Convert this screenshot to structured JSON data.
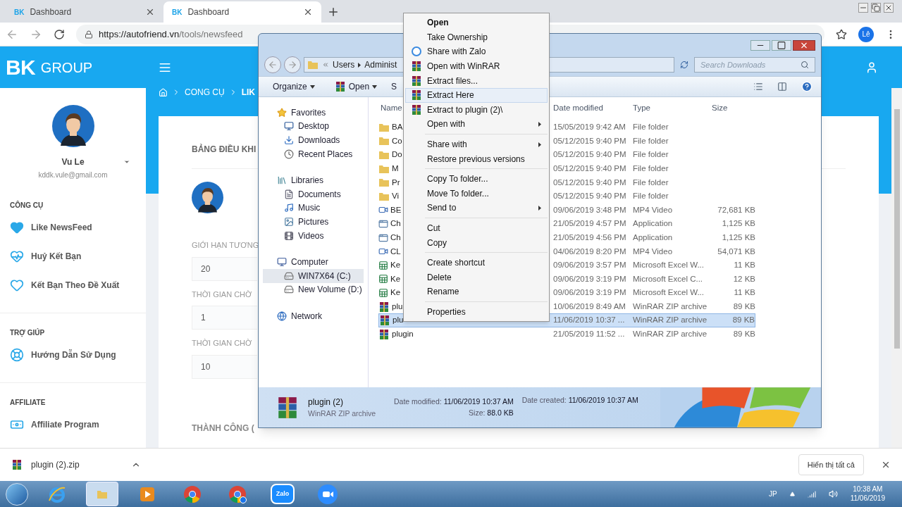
{
  "browser": {
    "tabs": [
      {
        "favicon": "BK",
        "title": "Dashboard",
        "selected": false
      },
      {
        "favicon": "BK",
        "title": "Dashboard",
        "selected": true
      }
    ],
    "url_host": "https://autofriend.vn",
    "url_path": "/tools/newsfeed",
    "profile": "Lê"
  },
  "page": {
    "logo": {
      "mark": "BK",
      "word": "GROUP"
    },
    "breadcrumb": [
      "CÔNG CỤ",
      "LIK"
    ],
    "user": {
      "name": "Vu Le",
      "email": "kddk.vule@gmail.com"
    },
    "sidebar": [
      {
        "title": "CÔNG CỤ",
        "items": [
          {
            "label": "Like NewsFeed",
            "kind": "heart"
          },
          {
            "label": "Huỷ Kết Bạn",
            "kind": "pulse"
          },
          {
            "label": "Kết Bạn Theo Đề Xuất",
            "kind": "heart-outline"
          }
        ]
      },
      {
        "title": "TRỢ GIÚP",
        "items": [
          {
            "label": "Hướng Dẫn Sử Dụng",
            "kind": "lifebuoy"
          }
        ]
      },
      {
        "title": "AFFILIATE",
        "items": [
          {
            "label": "Affiliate Program",
            "kind": "money"
          }
        ]
      }
    ],
    "dashboard": {
      "title": "BẢNG ĐIỀU KHI",
      "fields": [
        {
          "label": "GIỚI HẠN TƯƠNG",
          "value": "20"
        },
        {
          "label": "THỜI GIAN CHỜ",
          "value": "1"
        },
        {
          "label": "THỜI GIAN CHỜ",
          "value": "10"
        }
      ],
      "success": "THÀNH CÔNG ("
    }
  },
  "explorer": {
    "path": [
      "Users",
      "Administ"
    ],
    "search": "Search Downloads",
    "toolbar": [
      "Organize",
      "Open",
      "S"
    ],
    "tree": [
      {
        "label": "Favorites",
        "kind": "star",
        "children": [
          {
            "label": "Desktop",
            "kind": "desktop",
            "selected": false
          },
          {
            "label": "Downloads",
            "kind": "downloads",
            "selected": false
          },
          {
            "label": "Recent Places",
            "kind": "recent",
            "selected": false
          }
        ]
      },
      {
        "label": "Libraries",
        "kind": "libraries",
        "children": [
          {
            "label": "Documents",
            "kind": "documents",
            "selected": false
          },
          {
            "label": "Music",
            "kind": "music",
            "selected": false
          },
          {
            "label": "Pictures",
            "kind": "pictures",
            "selected": false
          },
          {
            "label": "Videos",
            "kind": "videos",
            "selected": false
          }
        ]
      },
      {
        "label": "Computer",
        "kind": "computer",
        "children": [
          {
            "label": "WIN7X64 (C:)",
            "kind": "drive",
            "selected": true
          },
          {
            "label": "New Volume (D:)",
            "kind": "drive",
            "selected": false
          }
        ]
      },
      {
        "label": "Network",
        "kind": "network"
      }
    ],
    "columns": [
      "Name",
      "Date modified",
      "Type",
      "Size"
    ],
    "files": [
      {
        "name": "BA",
        "kind": "folder",
        "date": "15/05/2019 9:42 AM",
        "type": "File folder",
        "selected": false
      },
      {
        "name": "Co",
        "kind": "folder",
        "date": "05/12/2015 9:40 PM",
        "type": "File folder",
        "selected": false
      },
      {
        "name": "Do",
        "kind": "folder",
        "date": "05/12/2015 9:40 PM",
        "type": "File folder",
        "selected": false
      },
      {
        "name": "M",
        "kind": "folder",
        "date": "05/12/2015 9:40 PM",
        "type": "File folder",
        "selected": false
      },
      {
        "name": "Pr",
        "kind": "folder",
        "date": "05/12/2015 9:40 PM",
        "type": "File folder",
        "selected": false
      },
      {
        "name": "Vi",
        "kind": "folder",
        "date": "05/12/2015 9:40 PM",
        "type": "File folder",
        "selected": false
      },
      {
        "name": "BE",
        "kind": "video",
        "date": "09/06/2019 3:48 PM",
        "type": "MP4 Video",
        "size": "72,681 KB",
        "selected": false
      },
      {
        "name": "Ch",
        "kind": "app",
        "date": "21/05/2019 4:57 PM",
        "type": "Application",
        "size": "1,125 KB",
        "selected": false
      },
      {
        "name": "Ch",
        "kind": "app",
        "date": "21/05/2019 4:56 PM",
        "type": "Application",
        "size": "1,125 KB",
        "selected": false
      },
      {
        "name": "CL",
        "kind": "video",
        "date": "04/06/2019 8:20 PM",
        "type": "MP4 Video",
        "size": "54,071 KB",
        "selected": false
      },
      {
        "name": "Ke",
        "kind": "excel",
        "date": "09/06/2019 3:57 PM",
        "type": "Microsoft Excel W...",
        "size": "11 KB",
        "selected": false
      },
      {
        "name": "Ke",
        "kind": "excel",
        "date": "09/06/2019 3:19 PM",
        "type": "Microsoft Excel C...",
        "size": "12 KB",
        "selected": false
      },
      {
        "name": "Ke",
        "kind": "excel",
        "date": "09/06/2019 3:19 PM",
        "type": "Microsoft Excel W...",
        "size": "11 KB",
        "selected": false
      },
      {
        "name": "plu",
        "kind": "winrar",
        "date": "10/06/2019 8:49 AM",
        "type": "WinRAR ZIP archive",
        "size": "89 KB",
        "selected": false
      },
      {
        "name": "plu",
        "kind": "winrar",
        "date": "11/06/2019 10:37 ...",
        "type": "WinRAR ZIP archive",
        "size": "89 KB",
        "selected": true
      },
      {
        "name": "plugin",
        "kind": "winrar",
        "date": "21/05/2019 11:52 ...",
        "type": "WinRAR ZIP archive",
        "size": "89 KB",
        "selected": false
      }
    ],
    "details": {
      "name": "plugin (2)",
      "type": "WinRAR ZIP archive",
      "modified_label": "Date modified:",
      "modified": "11/06/2019 10:37 AM",
      "created_label": "Date created:",
      "created": "11/06/2019 10:37 AM",
      "size_label": "Size:",
      "size": "88.0 KB"
    }
  },
  "context_menu": [
    [
      {
        "label": "Open",
        "kind": "none",
        "bold": true,
        "submenu": false,
        "selected": false
      },
      {
        "label": "Take Ownership",
        "kind": "none",
        "bold": false,
        "submenu": false,
        "selected": false
      },
      {
        "label": "Share with Zalo",
        "kind": "zalo",
        "bold": false,
        "submenu": false,
        "selected": false
      },
      {
        "label": "Open with WinRAR",
        "kind": "winrar",
        "bold": false,
        "submenu": false,
        "selected": false
      },
      {
        "label": "Extract files...",
        "kind": "winrar",
        "bold": false,
        "submenu": false,
        "selected": false
      },
      {
        "label": "Extract Here",
        "kind": "winrar",
        "bold": false,
        "submenu": false,
        "selected": true
      },
      {
        "label": "Extract to plugin (2)\\",
        "kind": "winrar",
        "bold": false,
        "submenu": false,
        "selected": false
      },
      {
        "label": "Open with",
        "kind": "none",
        "bold": false,
        "submenu": true,
        "selected": false
      }
    ],
    [
      {
        "label": "Share with",
        "kind": "none",
        "bold": false,
        "submenu": true,
        "selected": false
      },
      {
        "label": "Restore previous versions",
        "kind": "none",
        "bold": false,
        "submenu": false,
        "selected": false
      }
    ],
    [
      {
        "label": "Copy To folder...",
        "kind": "none",
        "bold": false,
        "submenu": false,
        "selected": false
      },
      {
        "label": "Move To folder...",
        "kind": "none",
        "bold": false,
        "submenu": false,
        "selected": false
      },
      {
        "label": "Send to",
        "kind": "none",
        "bold": false,
        "submenu": true,
        "selected": false
      }
    ],
    [
      {
        "label": "Cut",
        "kind": "none",
        "bold": false,
        "submenu": false,
        "selected": false
      },
      {
        "label": "Copy",
        "kind": "none",
        "bold": false,
        "submenu": false,
        "selected": false
      }
    ],
    [
      {
        "label": "Create shortcut",
        "kind": "none",
        "bold": false,
        "submenu": false,
        "selected": false
      },
      {
        "label": "Delete",
        "kind": "none",
        "bold": false,
        "submenu": false,
        "selected": false
      },
      {
        "label": "Rename",
        "kind": "none",
        "bold": false,
        "submenu": false,
        "selected": false
      }
    ],
    [
      {
        "label": "Properties",
        "kind": "none",
        "bold": false,
        "submenu": false,
        "selected": false
      }
    ]
  ],
  "download_bar": {
    "file": "plugin (2).zip",
    "show_all": "Hiển thị tất cả"
  },
  "taskbar": {
    "apps": [
      {
        "kind": "ie",
        "selected": false
      },
      {
        "kind": "explorer",
        "selected": true
      },
      {
        "kind": "media",
        "selected": false
      },
      {
        "kind": "chrome",
        "selected": false
      },
      {
        "kind": "chrome-profile",
        "selected": false
      },
      {
        "kind": "zalo",
        "label": "Zalo",
        "selected": false
      },
      {
        "kind": "zoom",
        "selected": false
      }
    ],
    "language": "JP",
    "time": "10:38 AM",
    "date": "11/06/2019"
  }
}
